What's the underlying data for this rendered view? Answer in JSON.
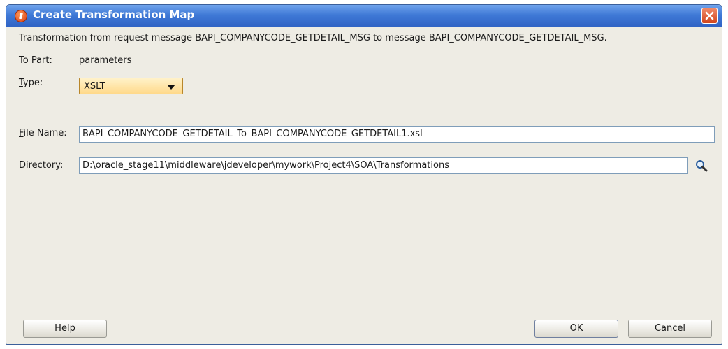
{
  "window": {
    "title": "Create Transformation Map"
  },
  "description": "Transformation from request message BAPI_COMPANYCODE_GETDETAIL_MSG to message BAPI_COMPANYCODE_GETDETAIL_MSG.",
  "form": {
    "to_part_label": "To Part:",
    "to_part_value": "parameters",
    "type_label_mnemonic": "T",
    "type_label_rest": "ype:",
    "type_value": "XSLT",
    "file_name_label_mnemonic": "F",
    "file_name_label_rest": "ile Name:",
    "file_name_value": "BAPI_COMPANYCODE_GETDETAIL_To_BAPI_COMPANYCODE_GETDETAIL1.xsl",
    "directory_label_mnemonic": "D",
    "directory_label_rest": "irectory:",
    "directory_value": "D:\\oracle_stage11\\middleware\\jdeveloper\\mywork\\Project4\\SOA\\Transformations"
  },
  "buttons": {
    "help_mnemonic": "H",
    "help_rest": "elp",
    "ok": "OK",
    "cancel": "Cancel"
  },
  "icons": {
    "title": "oracle-app-icon",
    "close": "close-icon",
    "search": "search-icon"
  }
}
